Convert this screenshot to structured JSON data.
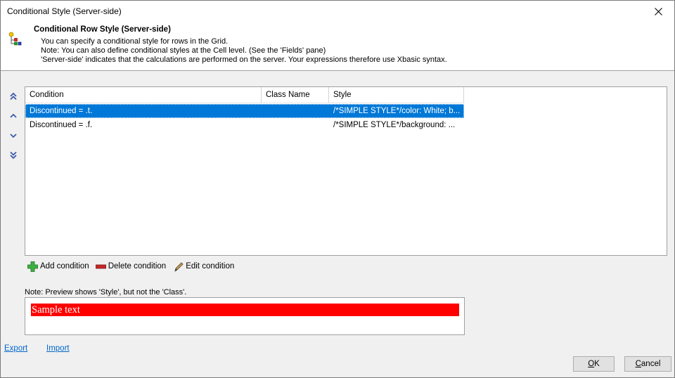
{
  "window": {
    "title": "Conditional Style (Server-side)"
  },
  "header": {
    "heading": "Conditional Row Style (Server-side)",
    "lines": [
      "You can specify a conditional style for rows in the Grid.",
      "Note: You can also define conditional styles at the Cell level. (See the 'Fields' pane)",
      "'Server-side' indicates that the calculations are performed on the server. Your expressions therefore use Xbasic syntax."
    ]
  },
  "move_buttons": [
    "move-to-top",
    "move-up",
    "move-down",
    "move-to-bottom"
  ],
  "grid": {
    "columns": [
      "Condition",
      "Class Name",
      "Style"
    ],
    "rows": [
      {
        "condition": "Discontinued = .t.",
        "class_name": "",
        "style": "/*SIMPLE STYLE*/color: White; b...",
        "selected": true
      },
      {
        "condition": "Discontinued = .f.",
        "class_name": "",
        "style": "/*SIMPLE STYLE*/background: ...",
        "selected": false
      }
    ]
  },
  "toolbar": {
    "add_label": "Add condition",
    "delete_label": "Delete condition",
    "edit_label": "Edit condition"
  },
  "preview": {
    "note": "Note: Preview shows 'Style', but not the 'Class'.",
    "sample_text": "Sample text"
  },
  "links": {
    "export_label": "Export",
    "import_label": "Import"
  },
  "buttons": {
    "ok_prefix": "O",
    "ok_rest": "K",
    "cancel_prefix": "C",
    "cancel_rest": "ancel"
  },
  "colors": {
    "selection": "#0078d7",
    "preview_background": "#ff0000",
    "preview_text": "#ffffff",
    "link": "#0066cc"
  }
}
